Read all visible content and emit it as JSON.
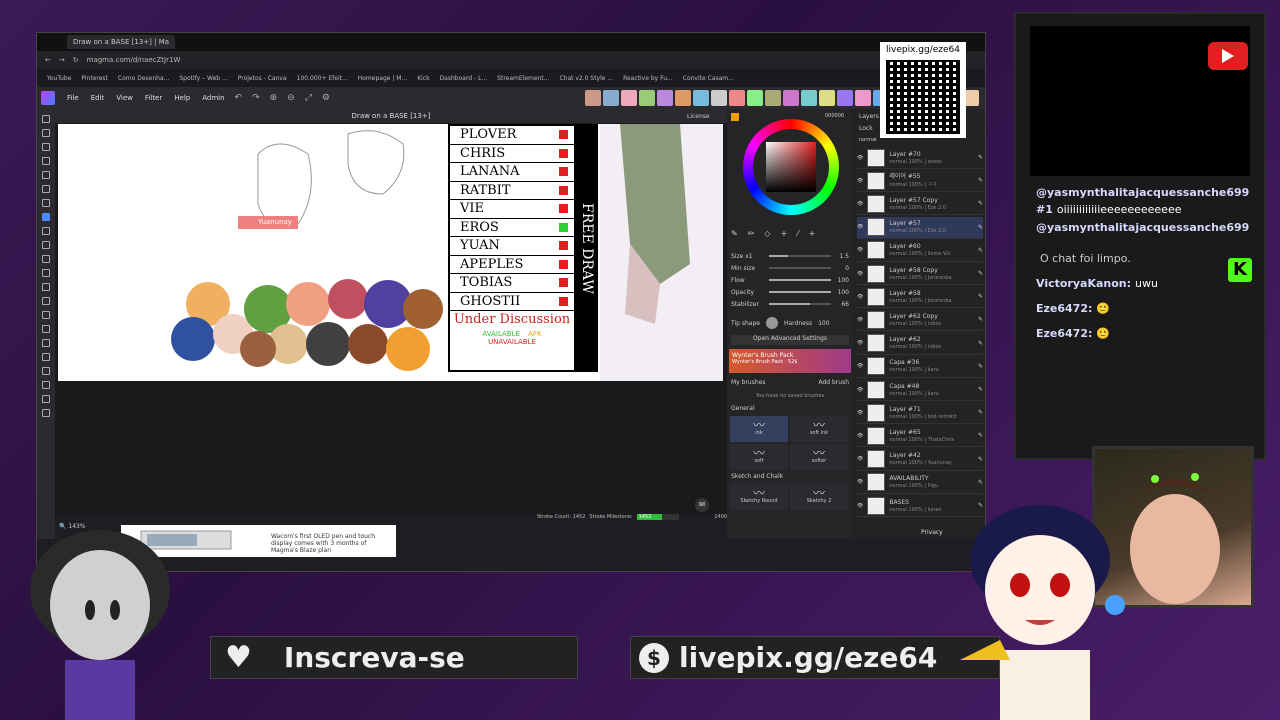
{
  "browser": {
    "tab_title": "Draw on a BASE [13+] | Ma",
    "url": "magma.com/d/naecZtJr1W",
    "bookmarks": [
      "YouTube",
      "Pinterest",
      "Como Desenha...",
      "Spotify – Web ...",
      "Projetos - Canva",
      "100.000+ Efeit...",
      "Homepage | M...",
      "Kick",
      "Dashboard - L...",
      "StreamElement...",
      "Chat v2.0 Style ...",
      "Reactive by Fu...",
      "Convite Casam..."
    ]
  },
  "app": {
    "menu": [
      "File",
      "Edit",
      "View",
      "Filter",
      "Help",
      "Admin"
    ],
    "doc_title": "Draw on a BASE [13+]",
    "zoom": "143%",
    "stroke_count_label": "Stroke Count: 1452",
    "stroke_milestone_label": "Stroke Milestone:",
    "stroke_current": "1452",
    "stroke_target": "2400",
    "stroke_progress": 0.605,
    "license": "License"
  },
  "canvas": {
    "cursor_label": "Yuanunay",
    "names": [
      {
        "name": "PLOVER",
        "status": "unavailable"
      },
      {
        "name": "CHRIS",
        "status": "unavailable"
      },
      {
        "name": "LANANA",
        "status": "unavailable"
      },
      {
        "name": "RATBIT",
        "status": "unavailable"
      },
      {
        "name": "VIE",
        "status": "unavailable"
      },
      {
        "name": "EROS",
        "status": "available"
      },
      {
        "name": "YUAN",
        "status": "unavailable"
      },
      {
        "name": "APEPLES",
        "status": "unavailable"
      },
      {
        "name": "TOBIAS",
        "status": "unavailable"
      },
      {
        "name": "GHOSTII",
        "status": "unavailable"
      }
    ],
    "under_discussion": "Under Discussion",
    "legend_available": "AVAILABLE",
    "legend_afk": "AFK",
    "legend_unavailable": "UNAVAILABLE",
    "side_text": "FREE DRAW",
    "colors": {
      "unavailable": "#e02020",
      "available": "#30d030"
    }
  },
  "brush": {
    "color_hex": "000000",
    "size_label": "Size x1",
    "size_val": "1.5",
    "min_size_label": "Min size",
    "min_size_val": "0",
    "flow_label": "Flow",
    "flow_val": "100",
    "opacity_label": "Opacity",
    "opacity_val": "100",
    "stabilizer_label": "Stabilizer",
    "stabilizer_val": "66",
    "hardness_label": "Hardness",
    "hardness_val": "100",
    "tip_shape_label": "Tip shape",
    "open_advanced": "Open Advanced Settings",
    "pack_title": "Wynter's Brush Pack",
    "pack_sub": "Wynter's Brush Pack · 52$",
    "my_brushes": "My brushes",
    "add_brush": "Add brush",
    "no_saved": "You have no saved brushes",
    "general": "General",
    "brushes": [
      "ink",
      "soft ink",
      "soft",
      "softer"
    ],
    "sketch_section": "Sketch and Chalk",
    "sketch_brushes": [
      "Sketchy Round",
      "Sketchy 2"
    ]
  },
  "layers": {
    "title": "Layers",
    "lock": "Lock",
    "blend": "normal",
    "items": [
      {
        "name": "Layer #70",
        "sub": "normal 100% | woosi"
      },
      {
        "name": "레이어 #55",
        "sub": "normal 100% | ㅋㅋ"
      },
      {
        "name": "Layer #57 Copy",
        "sub": "normal 100% | Eze 2.0"
      },
      {
        "name": "Layer #57",
        "sub": "normal 100% | Eze 2.0",
        "selected": true
      },
      {
        "name": "Layer #60",
        "sub": "normal 100% | ilome Vic"
      },
      {
        "name": "Layer #58 Copy",
        "sub": "normal 100% | Jororonba"
      },
      {
        "name": "Layer #58",
        "sub": "normal 100% | Jororonba"
      },
      {
        "name": "Layer #62 Copy",
        "sub": "normal 100% | ndios"
      },
      {
        "name": "Layer #62",
        "sub": "normal 100% | ndios"
      },
      {
        "name": "Capa #36",
        "sub": "normal 100% | karu"
      },
      {
        "name": "Capa #48",
        "sub": "normal 100% | karu"
      },
      {
        "name": "Layer #71",
        "sub": "normal 100% | lost-retrokit"
      },
      {
        "name": "Layer #65",
        "sub": "normal 100% | ThatsChris"
      },
      {
        "name": "Layer #42",
        "sub": "normal 100% | Yuanunay"
      },
      {
        "name": "AVAILABILITY",
        "sub": "normal 100% | Pigu"
      },
      {
        "name": "BASES",
        "sub": "normal 100% | lunen"
      }
    ],
    "privacy": "Privacy"
  },
  "ad": {
    "text": "Wacom's first OLED pen and touch display comes with 3 months of Magma's Blaze plan"
  },
  "overlay": {
    "qr_label": "livepix.gg/eze64",
    "chat_messages": [
      {
        "user": "@yasmynthalitajacquessanche699",
        "text": ""
      },
      {
        "user": "#1",
        "text": "oiiiiiiiiiiiieeeeeeeeeeee"
      },
      {
        "user": "@yasmynthalitajacquessanche699",
        "text": ""
      },
      {
        "user": "",
        "text": "O chat foi limpo."
      },
      {
        "user": "VictoryaKanon:",
        "text": "uwu"
      },
      {
        "user": "Eze6472:",
        "text": "🙂"
      },
      {
        "user": "Eze6472:",
        "text": "🙂"
      }
    ],
    "subscribe": "Inscreva-se",
    "livepix": "livepix.gg/eze64"
  }
}
